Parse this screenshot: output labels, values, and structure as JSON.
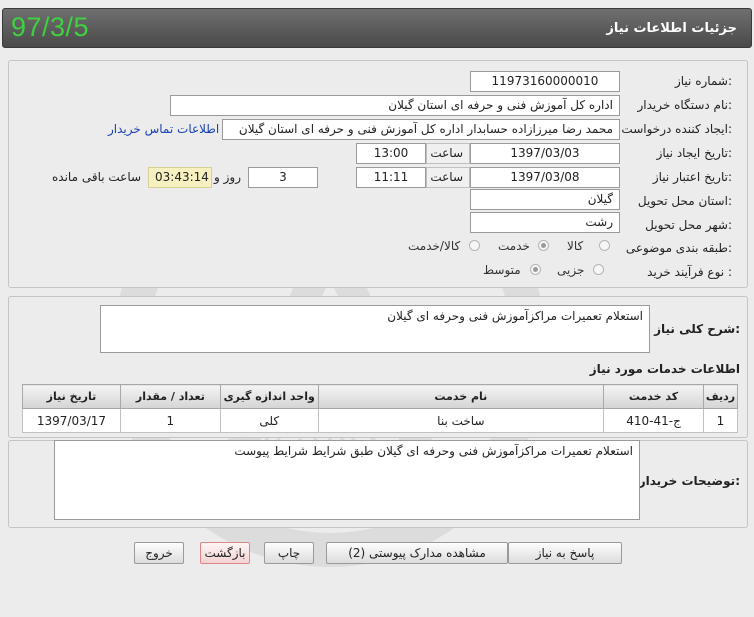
{
  "header": {
    "title": "جزئیات اطلاعات نیاز",
    "date": "97/3/5"
  },
  "form": {
    "need_number_label": "شماره نیاز:",
    "need_number": "11973160000010",
    "buyer_org_label": "نام دستگاه خریدار:",
    "buyer_org": "اداره کل آموزش فنی و حرفه ای استان گیلان",
    "requester_label": "ایجاد کننده درخواست:",
    "requester": "محمد رضا میرزازاده حسابدار اداره کل آموزش فنی و حرفه ای استان گیلان",
    "buyer_contact_link": "اطلاعات تماس خریدار",
    "creation_date_label": "تاریخ ایجاد نیاز:",
    "creation_date": "1397/03/03",
    "time_label": "ساعت",
    "creation_time": "13:00",
    "validity_date_label": "تاریخ اعتبار نیاز:",
    "validity_date": "1397/03/08",
    "validity_time": "11:11",
    "days_remaining": "3",
    "day_and_label": "روز و",
    "remaining_time": "03:43:14",
    "remaining_label": "ساعت باقی مانده",
    "province_label": "استان محل تحویل:",
    "province": "گیلان",
    "city_label": "شهر محل تحویل:",
    "city": "رشت",
    "category_label": "طبقه بندی موضوعی:",
    "category_options": [
      "کالا",
      "خدمت",
      "کالا/خدمت"
    ],
    "category_selected": "خدمت",
    "process_label": "نوع فرآیند خرید :",
    "process_options": [
      "جزیی",
      "متوسط"
    ],
    "process_selected": "متوسط"
  },
  "summary": {
    "label": "شرح کلی نیاز:",
    "text": "استعلام تعمیرات مراکزآموزش فنی وحرفه ای گیلان"
  },
  "services": {
    "section_title": "اطلاعات خدمات مورد نیاز",
    "columns": [
      "ردیف",
      "کد خدمت",
      "نام خدمت",
      "واحد اندازه گیری",
      "تعداد / مقدار",
      "تاریخ نیاز"
    ],
    "rows": [
      [
        "1",
        "ج-41-410",
        "ساخت بنا",
        "کلی",
        "1",
        "1397/03/17"
      ]
    ]
  },
  "buyer_notes": {
    "label": "توضیحات خریدار:",
    "text": "استعلام تعمیرات مراکزآموزش فنی وحرفه ای گیلان طبق شرایط شرایط پیوست"
  },
  "buttons": {
    "respond": "پاسخ به نیاز",
    "attachments": "مشاهده مدارک پیوستی (2)",
    "print": "چاپ",
    "back": "بازگشت",
    "exit": "خروج"
  },
  "watermark": {
    "text_main": "هزاره",
    "text_sub": "گستران"
  },
  "colors": {
    "header_bg": "#555555",
    "date_green": "#3fd13f",
    "link_blue": "#1a3fb8",
    "remaining_bg": "#f7f0c0"
  }
}
